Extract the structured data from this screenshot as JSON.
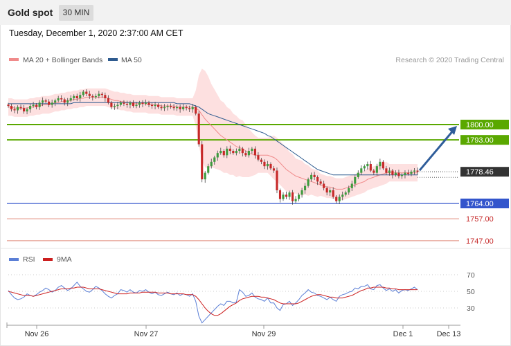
{
  "header": {
    "title": "Gold spot",
    "timeframe": "30 MIN"
  },
  "timestamp": "Tuesday, December 1, 2020 2:37:00 AM CET",
  "legend": [
    {
      "name": "MA 20 + Bollinger Bands",
      "color": "#f08a8a"
    },
    {
      "name": "MA 50",
      "color": "#2e5b8f"
    }
  ],
  "credit": "Research © 2020 Trading Central",
  "colors": {
    "up": "#3d9b3d",
    "down": "#c62828",
    "resistance": "#5aa800",
    "support": "#3355cc",
    "current": "#333333",
    "target_arrow": "#2f5d9a",
    "band": "#fde0e0"
  },
  "chart_data": [
    {
      "type": "candlestick",
      "title": "Gold spot",
      "x_tick_labels": [
        "Nov 26",
        "Nov 27",
        "Nov 29",
        "Dec 1",
        "Dec 13"
      ],
      "ylim": [
        1744,
        1822
      ],
      "current_price": "1778.46",
      "levels": [
        {
          "label": "1800.00",
          "value": 1800.0,
          "kind": "resistance"
        },
        {
          "label": "1793.00",
          "value": 1793.0,
          "kind": "resistance"
        },
        {
          "label": "1764.00",
          "value": 1764.0,
          "kind": "support"
        },
        {
          "label": "1757.00",
          "value": 1757.0,
          "kind": "support-minor"
        },
        {
          "label": "1747.00",
          "value": 1747.0,
          "kind": "support-minor"
        }
      ],
      "close": [
        1808.5,
        1807,
        1806.5,
        1808,
        1807.5,
        1806,
        1807,
        1808.5,
        1809,
        1808,
        1810,
        1811,
        1810.5,
        1809,
        1810,
        1811,
        1812,
        1811.5,
        1810,
        1811,
        1812,
        1813,
        1812,
        1813.5,
        1815,
        1814,
        1813,
        1812.5,
        1813,
        1814,
        1813.5,
        1812,
        1810,
        1808,
        1808.5,
        1809,
        1810,
        1809.5,
        1809,
        1810,
        1808.5,
        1809,
        1810,
        1809.5,
        1810,
        1809,
        1808.5,
        1809,
        1808,
        1807.5,
        1808,
        1808.5,
        1808,
        1807.5,
        1808,
        1807,
        1808,
        1807.5,
        1807,
        1808,
        1805,
        1791,
        1775,
        1778,
        1781,
        1783,
        1785,
        1787,
        1788,
        1786,
        1789,
        1788,
        1787,
        1788,
        1789,
        1787,
        1786,
        1788,
        1789,
        1786,
        1784,
        1783,
        1781,
        1782,
        1780,
        1779,
        1770,
        1766,
        1768,
        1767,
        1769,
        1765,
        1766,
        1768,
        1770,
        1772,
        1775,
        1777,
        1776,
        1774,
        1773,
        1771,
        1769,
        1770,
        1767,
        1765,
        1767,
        1768,
        1769,
        1771,
        1773,
        1776,
        1778,
        1780,
        1781,
        1782,
        1779,
        1778,
        1781,
        1783,
        1780,
        1778,
        1779,
        1777,
        1778,
        1776.5,
        1777,
        1778,
        1777.5,
        1778.5,
        1779,
        1778.46
      ],
      "ma20": [
        1808,
        1808,
        1807.5,
        1807.5,
        1807.5,
        1807.5,
        1807.5,
        1808,
        1808,
        1808.5,
        1808.5,
        1809,
        1809,
        1809,
        1809.5,
        1810,
        1810,
        1810.5,
        1810.5,
        1811,
        1811,
        1811.5,
        1811.5,
        1812,
        1812,
        1812.5,
        1812.5,
        1812.5,
        1812.5,
        1812.5,
        1812.5,
        1812.5,
        1812,
        1811.5,
        1811,
        1811,
        1810.5,
        1810.5,
        1810,
        1810,
        1809.5,
        1809.5,
        1809.5,
        1809.5,
        1809.5,
        1809,
        1809,
        1809,
        1809,
        1808.5,
        1808.5,
        1808.5,
        1808.5,
        1808.5,
        1808,
        1808,
        1808,
        1808,
        1808,
        1808,
        1807.5,
        1806.5,
        1804.5,
        1802.5,
        1801,
        1799.5,
        1798,
        1796.5,
        1795,
        1794,
        1793,
        1792,
        1791,
        1790,
        1789.5,
        1789,
        1788,
        1787,
        1786.5,
        1786,
        1786,
        1786,
        1786,
        1786,
        1785.5,
        1785,
        1784,
        1782.5,
        1781,
        1779.5,
        1778.5,
        1777.5,
        1776.5,
        1776,
        1775.5,
        1775,
        1774.5,
        1774,
        1773.5,
        1773,
        1772.5,
        1772,
        1771.5,
        1771.5,
        1771,
        1770.5,
        1770.5,
        1770.5,
        1771,
        1771.5,
        1772,
        1772.5,
        1773,
        1773.5,
        1774,
        1775,
        1775.5,
        1776,
        1776.5,
        1777,
        1777.5,
        1778,
        1778,
        1778,
        1778,
        1778,
        1778,
        1778,
        1778,
        1778,
        1778,
        1778
      ],
      "ma50": [
        1809.5,
        1809.5,
        1809.5,
        1809.5,
        1809.5,
        1809.5,
        1809.5,
        1809.5,
        1809.5,
        1809.5,
        1809.5,
        1809.5,
        1809.5,
        1809.5,
        1809.5,
        1809.5,
        1809.5,
        1809.5,
        1809.5,
        1809.5,
        1809.5,
        1810,
        1810,
        1810,
        1810,
        1810,
        1810,
        1810,
        1810,
        1810,
        1810,
        1810,
        1810,
        1810,
        1810,
        1810,
        1810,
        1810,
        1810,
        1810,
        1810,
        1810,
        1810,
        1810,
        1810,
        1810,
        1810,
        1810,
        1810,
        1810,
        1810,
        1810,
        1810,
        1810,
        1809.5,
        1809.5,
        1809.5,
        1809.5,
        1809.5,
        1809,
        1808.5,
        1808,
        1807,
        1806,
        1805,
        1804.5,
        1804,
        1803.5,
        1803,
        1802.5,
        1802,
        1801.5,
        1801,
        1800.5,
        1800,
        1799.5,
        1799,
        1798.5,
        1798,
        1797.5,
        1797,
        1796.5,
        1796,
        1795,
        1794.5,
        1793.5,
        1792.5,
        1791.5,
        1790.5,
        1789.5,
        1788.5,
        1787.5,
        1786.5,
        1785.5,
        1784.5,
        1783.5,
        1782.5,
        1781.5,
        1780.5,
        1779.5,
        1779,
        1778.5,
        1778,
        1777.5,
        1777,
        1777,
        1777,
        1777,
        1777,
        1777,
        1777,
        1777,
        1777,
        1777,
        1777,
        1777,
        1777,
        1777,
        1777,
        1777,
        1777,
        1777,
        1777,
        1777,
        1777,
        1777,
        1777,
        1777,
        1777,
        1777,
        1777,
        1777,
        1777,
        1777
      ],
      "band_width": [
        4,
        4,
        4,
        4,
        4,
        4,
        4,
        4,
        4,
        4,
        4,
        4,
        4,
        4,
        4,
        4,
        4,
        4,
        4,
        4,
        4,
        4,
        4,
        4,
        4,
        4,
        4,
        4,
        4,
        4,
        4,
        4,
        4,
        4,
        4,
        4,
        4,
        4,
        4,
        4,
        4,
        4,
        4,
        4,
        4,
        4,
        4,
        4,
        4,
        4,
        4,
        4,
        4,
        4,
        4,
        4,
        4,
        4,
        4,
        4,
        8,
        16,
        21,
        22,
        21,
        19,
        18,
        17,
        16,
        16,
        15,
        15,
        14,
        14,
        13,
        13,
        12,
        11,
        10,
        9,
        8,
        8,
        8,
        8,
        9,
        10,
        10,
        10,
        10,
        10,
        9,
        9,
        8,
        8,
        8,
        7,
        7,
        6,
        6,
        6,
        5,
        5,
        5,
        5,
        5,
        5,
        5,
        5,
        5,
        5,
        5,
        5,
        5,
        5,
        5,
        5,
        5,
        5,
        5,
        5,
        5,
        5,
        4,
        4,
        4,
        4,
        4,
        4,
        4,
        4,
        4,
        4
      ]
    },
    {
      "type": "line",
      "legend": [
        "RSI",
        "9MA"
      ],
      "yticks": [
        70,
        50,
        30
      ],
      "ylim": [
        10,
        90
      ],
      "rsi": [
        51,
        46,
        42,
        40,
        41,
        43,
        47,
        45,
        44,
        46,
        49,
        51,
        54,
        52,
        49,
        51,
        55,
        57,
        54,
        51,
        53,
        57,
        61,
        56,
        53,
        50,
        49,
        52,
        56,
        54,
        51,
        47,
        44,
        42,
        45,
        47,
        52,
        51,
        49,
        52,
        49,
        48,
        51,
        50,
        52,
        49,
        47,
        49,
        46,
        45,
        47,
        49,
        47,
        46,
        48,
        45,
        47,
        46,
        44,
        47,
        38,
        20,
        12,
        16,
        20,
        24,
        28,
        32,
        35,
        33,
        38,
        38,
        36,
        37,
        52,
        49,
        44,
        45,
        48,
        43,
        41,
        40,
        38,
        42,
        36,
        36,
        30,
        27,
        34,
        35,
        38,
        33,
        36,
        40,
        45,
        48,
        52,
        49,
        48,
        45,
        44,
        42,
        40,
        43,
        40,
        38,
        44,
        46,
        47,
        49,
        50,
        54,
        53,
        56,
        56,
        58,
        53,
        52,
        57,
        58,
        54,
        51,
        53,
        50,
        52,
        48,
        51,
        52,
        51,
        53,
        55,
        52
      ],
      "ma9": [
        50,
        49,
        48,
        47,
        46,
        45,
        45,
        45,
        44,
        45,
        46,
        47,
        48,
        49,
        50,
        51,
        52,
        53,
        53,
        53,
        54,
        54,
        55,
        55,
        55,
        54,
        53,
        53,
        53,
        53,
        52,
        51,
        50,
        49,
        48,
        47,
        47,
        47,
        47,
        48,
        48,
        48,
        48,
        49,
        49,
        49,
        49,
        49,
        48,
        48,
        48,
        48,
        47,
        47,
        47,
        47,
        47,
        46,
        46,
        46,
        44,
        40,
        35,
        30,
        26,
        23,
        21,
        21,
        23,
        26,
        29,
        32,
        34,
        36,
        39,
        41,
        42,
        43,
        44,
        44,
        44,
        43,
        43,
        42,
        41,
        40,
        38,
        36,
        35,
        35,
        35,
        35,
        35,
        36,
        38,
        40,
        42,
        44,
        45,
        46,
        46,
        45,
        44,
        43,
        43,
        42,
        42,
        42,
        43,
        44,
        45,
        47,
        49,
        51,
        52,
        54,
        54,
        55,
        55,
        55,
        55,
        54,
        54,
        53,
        53,
        52,
        52,
        52,
        52,
        52,
        52,
        52
      ]
    }
  ]
}
